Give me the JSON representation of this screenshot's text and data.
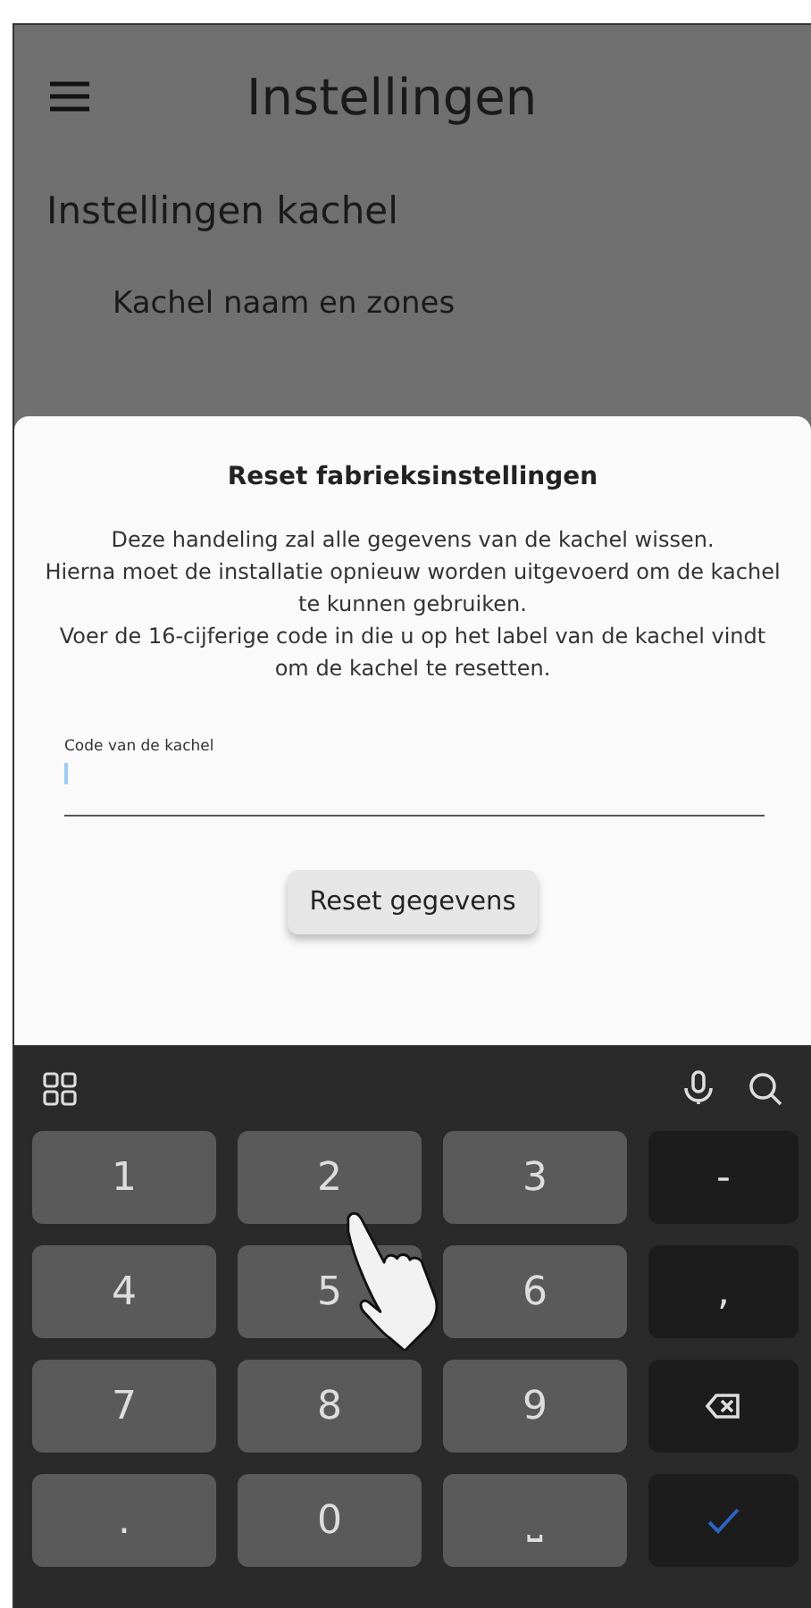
{
  "app_bar": {
    "title": "Instellingen"
  },
  "settings": {
    "section_title": "Instellingen kachel",
    "items": [
      "Kachel naam en zones"
    ]
  },
  "dialog": {
    "title": "Reset fabrieksinstellingen",
    "message": "Deze handeling zal alle gegevens van de kachel wissen.\nHierna moet de installatie opnieuw worden uitgevoerd om de kachel te kunnen gebruiken.\nVoer de 16-cijferige code in die u op het label van de kachel vindt om de kachel te resetten.",
    "field": {
      "label": "Code van de kachel",
      "focused": true
    },
    "button": "Reset gegevens"
  },
  "keyboard": {
    "keys": [
      {
        "kind": "digit",
        "label": "1"
      },
      {
        "kind": "digit",
        "label": "2"
      },
      {
        "kind": "digit",
        "label": "3"
      },
      {
        "kind": "symbol",
        "label": "-"
      },
      {
        "kind": "digit",
        "label": "4"
      },
      {
        "kind": "digit",
        "label": "5"
      },
      {
        "kind": "digit",
        "label": "6"
      },
      {
        "kind": "symbol",
        "label": ","
      },
      {
        "kind": "digit",
        "label": "7"
      },
      {
        "kind": "digit",
        "label": "8"
      },
      {
        "kind": "digit",
        "label": "9"
      },
      {
        "kind": "backspace"
      },
      {
        "kind": "digit",
        "label": "."
      },
      {
        "kind": "digit",
        "label": "0"
      },
      {
        "kind": "digit",
        "label": "⎵"
      },
      {
        "kind": "enter"
      }
    ]
  }
}
